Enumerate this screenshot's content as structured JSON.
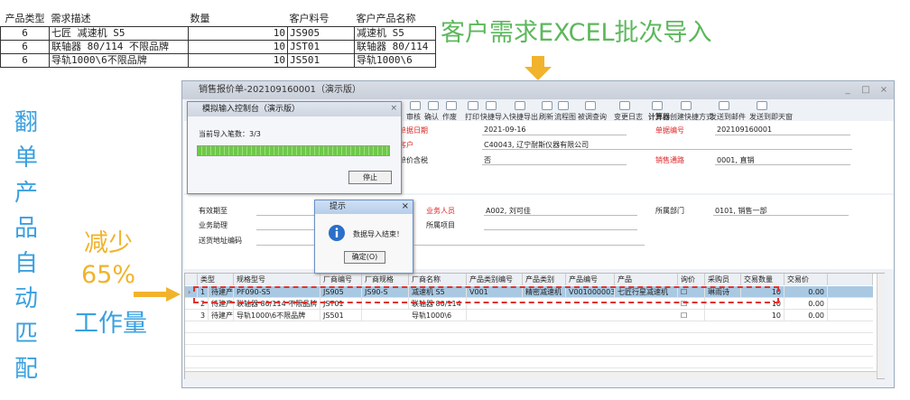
{
  "excel": {
    "headers": [
      "产品类型",
      "需求描述",
      "数量",
      "客户料号",
      "客户产品名称"
    ],
    "rows": [
      [
        "6",
        "七匠 减速机 S5",
        "10",
        "JS905",
        "减速机 S5"
      ],
      [
        "6",
        "联轴器 80/114 不限品牌",
        "10",
        "JST01",
        "联轴器 80/114"
      ],
      [
        "6",
        "导轨1000\\6不限品牌",
        "10",
        "JS501",
        "导轨1000\\6"
      ]
    ]
  },
  "headline": "客户需求EXCEL批次导入",
  "vertical_text": [
    "翻",
    "单",
    "产",
    "品",
    "自",
    "动",
    "匹",
    "配"
  ],
  "reduce": {
    "line1": "减少",
    "line2": "65%",
    "line3": "工作量"
  },
  "window": {
    "title": "销售报价单-202109160001（演示版）",
    "toolbar": [
      "审核",
      "确认",
      "作废",
      "打印",
      "快捷导入",
      "快捷导出",
      "刷新",
      "流程图",
      "被调查询",
      "变更日志",
      "计算器",
      "创建快捷方式",
      "发送到邮件",
      "发送到即天窗"
    ],
    "form1": {
      "date_label": "单据日期",
      "date_value": "2021-09-16",
      "customer_label": "客户",
      "customer_value": "C40043, 辽宁耐斯仪器有限公司",
      "tax_label": "单价含税",
      "tax_value": "否",
      "docno_label": "单据编号",
      "docno_value": "202109160001",
      "channel_label": "销售通路",
      "channel_value": "0001, 直销"
    },
    "form2": {
      "valid_label": "有效期至",
      "assist_label": "业务助理",
      "addr_label": "送货地址编码",
      "sales_label": "业务人员",
      "sales_value": "A002, 刘可佳",
      "project_label": "所属项目",
      "dept_label": "所属部门",
      "dept_value": "0101, 销售一部"
    },
    "grid": {
      "headers": [
        "类型",
        "规格型号",
        "厂商编号",
        "厂商规格",
        "厂商名称",
        "产品类别编号",
        "产品类别",
        "产品编号",
        "产品",
        "询价",
        "采购员",
        "交易数量",
        "交易价"
      ],
      "rows": [
        [
          "1",
          "待建产品",
          "PF090-S5",
          "JS905",
          "JS90-S",
          "减速机 S5",
          "V001",
          "精密减速机",
          "V001000003",
          "七匠行星减速机",
          "",
          "琳雨诗",
          "10",
          "0.00"
        ],
        [
          "2",
          "待建产品",
          "联轴器 80/114 不限品牌",
          "JST01",
          "",
          "联轴器 80/114",
          "",
          "",
          "",
          "",
          "",
          "",
          "10",
          "0.00"
        ],
        [
          "3",
          "待建产品",
          "导轨1000\\6不限品牌",
          "JS501",
          "",
          "导轨1000\\6",
          "",
          "",
          "",
          "",
          "",
          "",
          "10",
          "0.00"
        ]
      ]
    }
  },
  "import_dialog": {
    "title": "模拟输入控制台（演示版）",
    "count_label": "当前导入笔数：",
    "count_value": "3/3",
    "progress": 1.0,
    "stop_label": "停止"
  },
  "tip_dialog": {
    "title": "提示",
    "message": "数据导入结束！",
    "ok_label": "确定(O)"
  },
  "colors": {
    "green": "#5cb85c",
    "blue": "#3aa0e0",
    "orange": "#f1b32b",
    "dash": "#e0322e",
    "selected_row": "#a9c9e3"
  }
}
